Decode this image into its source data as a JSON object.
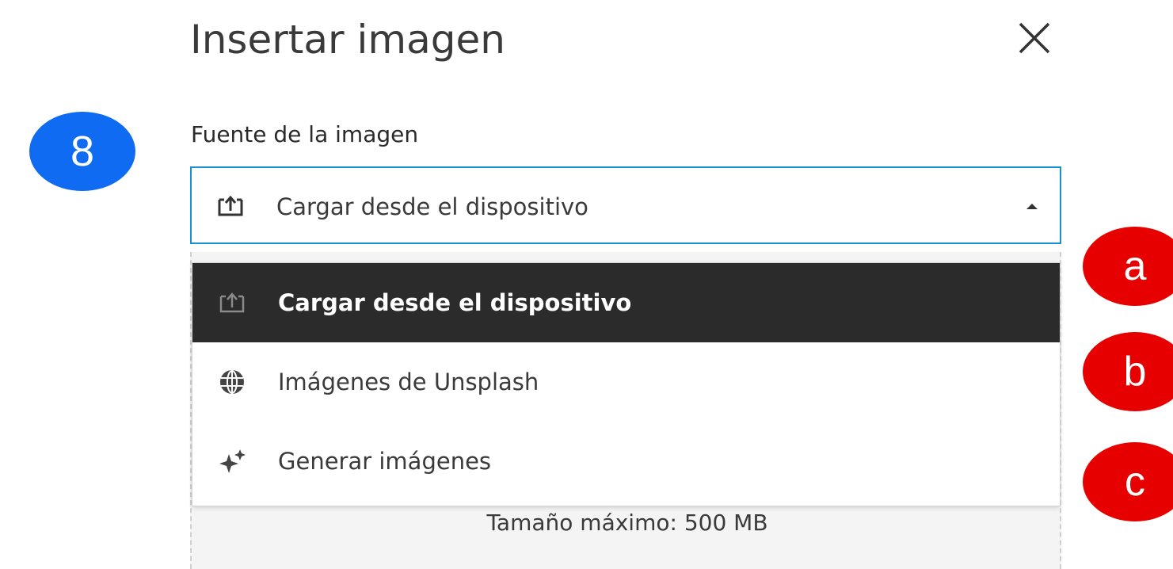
{
  "dialog": {
    "title": "Insertar imagen",
    "close_icon": "close-icon",
    "field_label": "Fuente de la imagen",
    "select": {
      "value": "Cargar desde el dispositivo",
      "icon": "upload-icon",
      "caret_icon": "caret-up-icon",
      "state": "expanded",
      "border_color": "#1a8fd8"
    },
    "menu": {
      "items": [
        {
          "label": "Cargar desde el dispositivo",
          "icon": "upload-icon",
          "selected": true
        },
        {
          "label": "Imágenes de Unsplash",
          "icon": "globe-icon",
          "selected": false
        },
        {
          "label": "Generar imágenes",
          "icon": "sparkle-icon",
          "selected": false
        }
      ],
      "selected_bg": "#2b2b2b"
    },
    "upload_area": {
      "max_size_text": "Tamaño máximo: 500 MB"
    }
  },
  "annotations": {
    "step_badge": {
      "label": "8",
      "color": "#0f6bf2"
    },
    "markers": [
      {
        "label": "a",
        "color": "#e60000"
      },
      {
        "label": "b",
        "color": "#e60000"
      },
      {
        "label": "c",
        "color": "#e60000"
      }
    ]
  }
}
